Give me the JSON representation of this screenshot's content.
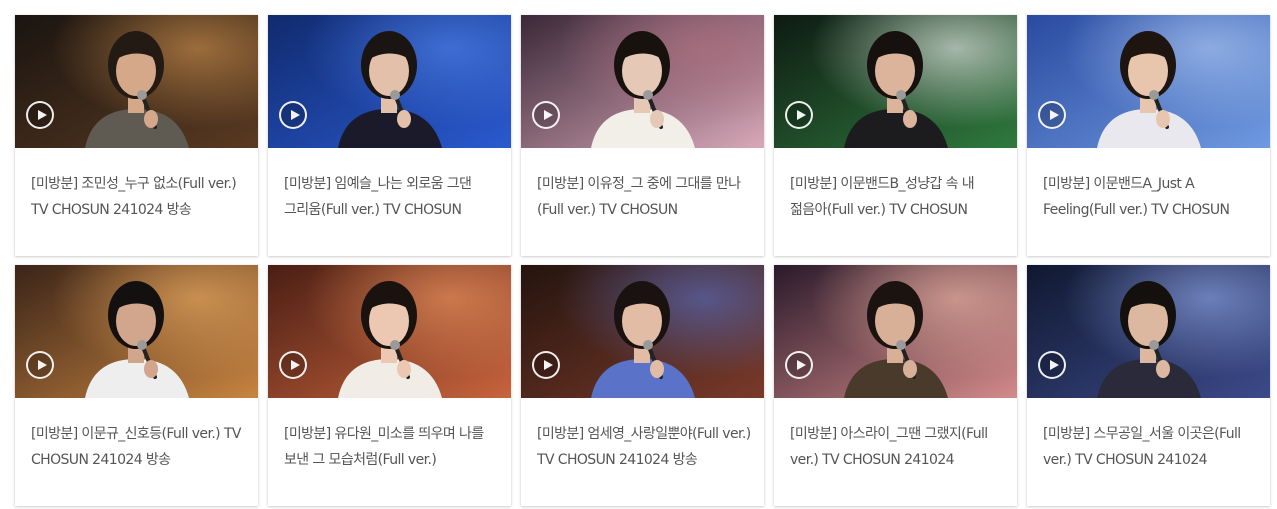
{
  "videos": [
    {
      "title": "[미방분] 조민성_누구 없소(Full ver.) TV CHOSUN 241024 방송",
      "scene": {
        "bg1": "#1a1410",
        "bg2": "#5a3a22",
        "accent": "#c58a4a",
        "shirt": "#5f5b52",
        "hair": "#241a14",
        "skin": "#d4a888"
      }
    },
    {
      "title": "[미방분] 임예슬_나는 외로움 그댄 그리움(Full ver.) TV CHOSUN",
      "scene": {
        "bg1": "#102a6e",
        "bg2": "#2a5ad0",
        "accent": "#4c7fe8",
        "shirt": "#1a1a2a",
        "hair": "#1a1412",
        "skin": "#e2c0aa"
      }
    },
    {
      "title": "[미방분] 이유정_그 중에 그대를 만나(Full ver.) TV CHOSUN",
      "scene": {
        "bg1": "#3a2838",
        "bg2": "#d8a8b8",
        "accent": "#b07080",
        "shirt": "#f2eee8",
        "hair": "#18120e",
        "skin": "#e6c8b6"
      }
    },
    {
      "title": "[미방분] 이문밴드B_성냥갑 속 내 젊음아(Full ver.) TV CHOSUN",
      "scene": {
        "bg1": "#0e1a12",
        "bg2": "#2f7a3e",
        "accent": "#e0e6e0",
        "shirt": "#1c1c1e",
        "hair": "#16110e",
        "skin": "#dcb49c"
      }
    },
    {
      "title": "[미방분] 이문밴드A_Just A Feeling(Full ver.) TV CHOSUN",
      "scene": {
        "bg1": "#2a4aa0",
        "bg2": "#6f9ae0",
        "accent": "#a8c4f0",
        "shirt": "#e8e8ee",
        "hair": "#1e1510",
        "skin": "#e8c6ae"
      }
    },
    {
      "title": "[미방분] 이문규_신호등(Full ver.) TV CHOSUN 241024 방송",
      "scene": {
        "bg1": "#3a2418",
        "bg2": "#c88440",
        "accent": "#e8a860",
        "shirt": "#eeeeee",
        "hair": "#151010",
        "skin": "#d2a68c"
      }
    },
    {
      "title": "[미방분] 유다원_미소를 띄우며 나를 보낸 그 모습처럼(Full ver.)",
      "scene": {
        "bg1": "#4a1e14",
        "bg2": "#c8643c",
        "accent": "#e8905c",
        "shirt": "#f2ece6",
        "hair": "#1a120e",
        "skin": "#ecc8b2"
      }
    },
    {
      "title": "[미방분] 엄세영_사랑일뿐야(Full ver.) TV CHOSUN 241024 방송",
      "scene": {
        "bg1": "#24140e",
        "bg2": "#7a3a2a",
        "accent": "#5a6ab8",
        "shirt": "#5a72c8",
        "hair": "#1a1210",
        "skin": "#e2bca4"
      }
    },
    {
      "title": "[미방분] 아스라이_그땐 그랬지(Full ver.) TV CHOSUN 241024",
      "scene": {
        "bg1": "#2a1a2a",
        "bg2": "#d48a8a",
        "accent": "#e8b0a0",
        "shirt": "#4a3a2c",
        "hair": "#1a130f",
        "skin": "#d8b098"
      }
    },
    {
      "title": "[미방분] 스무공일_서울 이곳은(Full ver.) TV CHOSUN 241024",
      "scene": {
        "bg1": "#101830",
        "bg2": "#3c4a8a",
        "accent": "#8aa0e0",
        "shirt": "#2a2a3a",
        "hair": "#14100e",
        "skin": "#dcb8a0"
      }
    }
  ]
}
